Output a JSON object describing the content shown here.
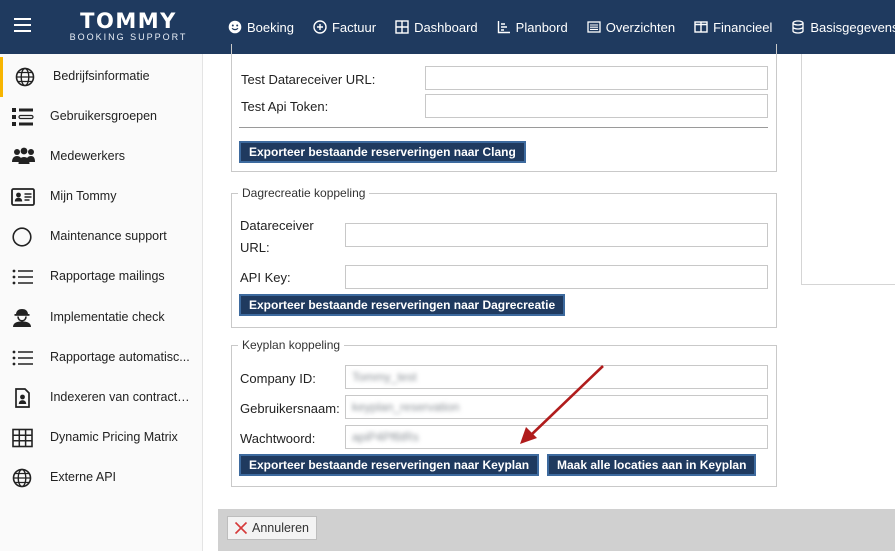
{
  "header": {
    "logo": {
      "main": "TOMMY",
      "sub": "BOOKING SUPPORT"
    },
    "nav": [
      {
        "label": "Boeking",
        "icon": "smiley-icon"
      },
      {
        "label": "Factuur",
        "icon": "plus-circle-icon"
      },
      {
        "label": "Dashboard",
        "icon": "grid-icon"
      },
      {
        "label": "Planbord",
        "icon": "chart-icon"
      },
      {
        "label": "Overzichten",
        "icon": "list-box-icon"
      },
      {
        "label": "Financieel",
        "icon": "columns-icon"
      },
      {
        "label": "Basisgegevens",
        "icon": "database-icon"
      }
    ]
  },
  "sidebar": {
    "accent_color": "#f7b500",
    "items": [
      {
        "label": "Bedrijfsinformatie",
        "icon": "globe-icon",
        "active": true
      },
      {
        "label": "Gebruikersgroepen",
        "icon": "user-groups-icon"
      },
      {
        "label": "Medewerkers",
        "icon": "employees-icon"
      },
      {
        "label": "Mijn Tommy",
        "icon": "id-card-icon"
      },
      {
        "label": "Maintenance support",
        "icon": "circle-icon"
      },
      {
        "label": "Rapportage mailings",
        "icon": "list-icon"
      },
      {
        "label": "Implementatie check",
        "icon": "worker-icon"
      },
      {
        "label": "Rapportage automatisc...",
        "icon": "list-icon"
      },
      {
        "label": "Indexeren van contract ...",
        "icon": "document-user-icon"
      },
      {
        "label": "Dynamic Pricing Matrix",
        "icon": "table-grid-icon"
      },
      {
        "label": "Externe API",
        "icon": "globe-icon"
      }
    ]
  },
  "clang": {
    "receiver_label": "Test Datareceiver URL:",
    "receiver_value": "",
    "token_label": "Test Api Token:",
    "token_value": "",
    "export_button": "Exporteer bestaande reserveringen naar Clang"
  },
  "dagrecreatie": {
    "legend": "Dagrecreatie koppeling",
    "receiver_label_1": "Datareceiver",
    "receiver_label_2": "URL:",
    "receiver_value": "",
    "api_key_label": "API Key:",
    "api_key_value": "",
    "export_button": "Exporteer bestaande reserveringen naar Dagrecreatie"
  },
  "keyplan": {
    "legend": "Keyplan koppeling",
    "company_label": "Company ID:",
    "company_value": "Tommy_test",
    "username_label": "Gebruikersnaam:",
    "username_value": "keyplan_reservation",
    "password_label": "Wachtwoord:",
    "password_value": "apiP4Pf6tRs",
    "export_button": "Exporteer bestaande reserveringen naar Keyplan",
    "locations_button": "Maak alle locaties aan in Keyplan"
  },
  "footer": {
    "cancel_label": "Annuleren"
  },
  "colors": {
    "header_bg": "#1f3a5f",
    "button_bg": "#1f3a5f",
    "arrow": "#b01c1c"
  }
}
